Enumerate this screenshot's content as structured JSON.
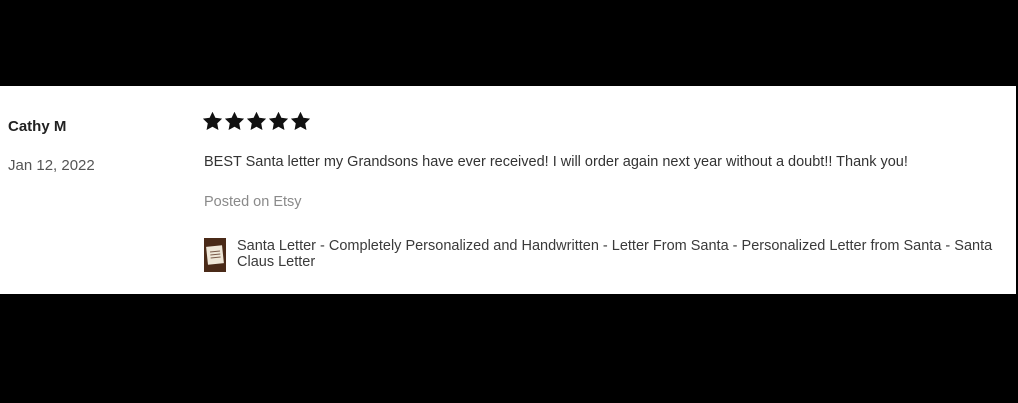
{
  "review": {
    "reviewer_name": "Cathy M",
    "date": "Jan 12, 2022",
    "rating": 5,
    "rating_max": 5,
    "text": "BEST Santa letter my Grandsons have ever received! I will order again next year without a doubt!! Thank you!",
    "source": "Posted on Etsy"
  },
  "product": {
    "title": "Santa Letter - Completely Personalized and Handwritten - Letter From Santa - Personalized Letter from Santa - Santa Claus Letter",
    "thumbnail_icon": "santa-letter-thumbnail"
  },
  "colors": {
    "background_band": "#000000",
    "card": "#ffffff",
    "star": "#111111"
  }
}
